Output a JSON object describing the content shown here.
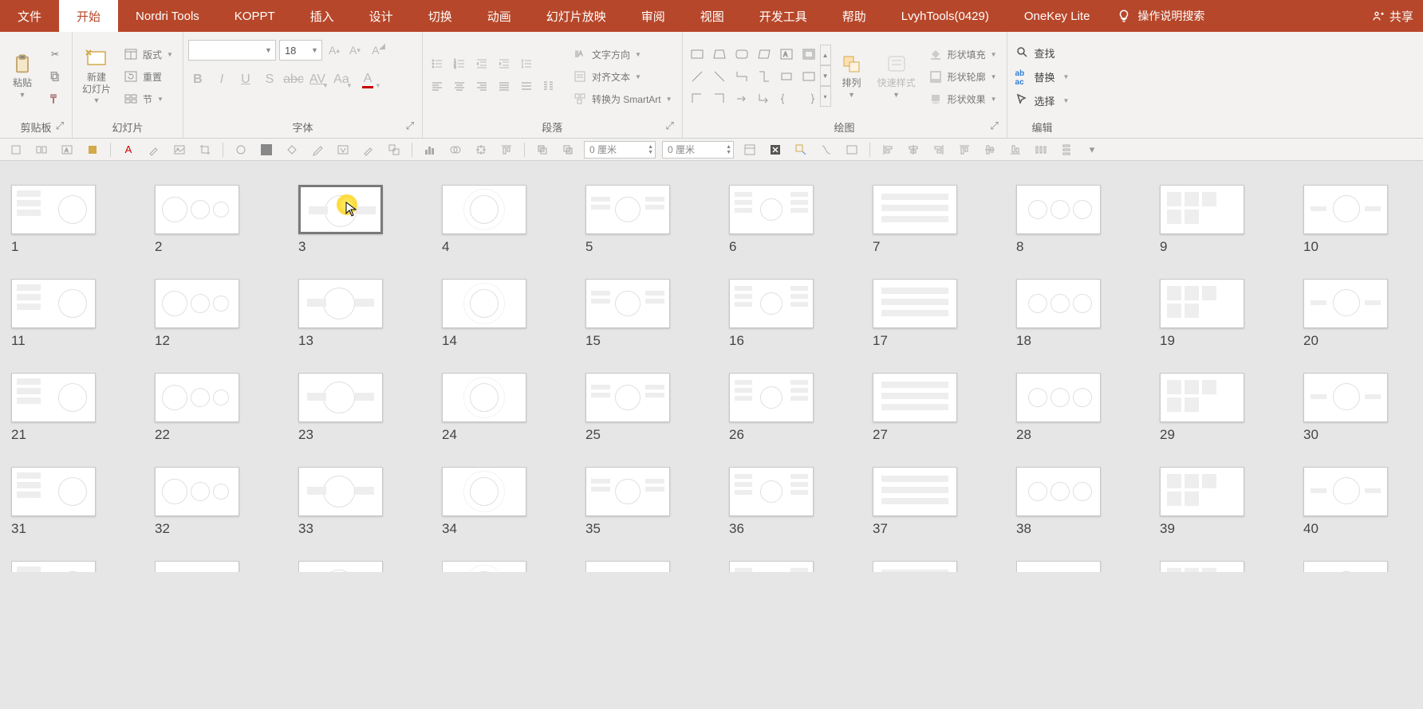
{
  "tabs": {
    "file": "文件",
    "home": "开始",
    "nordri": "Nordri Tools",
    "koppt": "KOPPT",
    "insert": "插入",
    "design": "设计",
    "transitions": "切换",
    "animations": "动画",
    "slideshow": "幻灯片放映",
    "review": "审阅",
    "view": "视图",
    "developer": "开发工具",
    "help": "帮助",
    "lvyh": "LvyhTools(0429)",
    "onekey": "OneKey Lite",
    "tellme": "操作说明搜索",
    "share": "共享"
  },
  "ribbon": {
    "clipboard": {
      "paste": "粘贴",
      "label": "剪贴板"
    },
    "slides": {
      "new_slide": "新建\n幻灯片",
      "layout": "版式",
      "reset": "重置",
      "section": "节",
      "label": "幻灯片"
    },
    "font": {
      "size": "18",
      "label": "字体"
    },
    "paragraph": {
      "text_dir": "文字方向",
      "align_text": "对齐文本",
      "smartart": "转换为 SmartArt",
      "label": "段落"
    },
    "drawing": {
      "arrange": "排列",
      "quick_styles": "快速样式",
      "shape_fill": "形状填充",
      "shape_outline": "形状轮廓",
      "shape_effects": "形状效果",
      "label": "绘图"
    },
    "editing": {
      "find": "查找",
      "replace": "替换",
      "select": "选择",
      "label": "编辑"
    }
  },
  "qat": {
    "dim1": "0 厘米",
    "dim2": "0 厘米"
  },
  "slides_count": 40,
  "selected_slide": 3
}
